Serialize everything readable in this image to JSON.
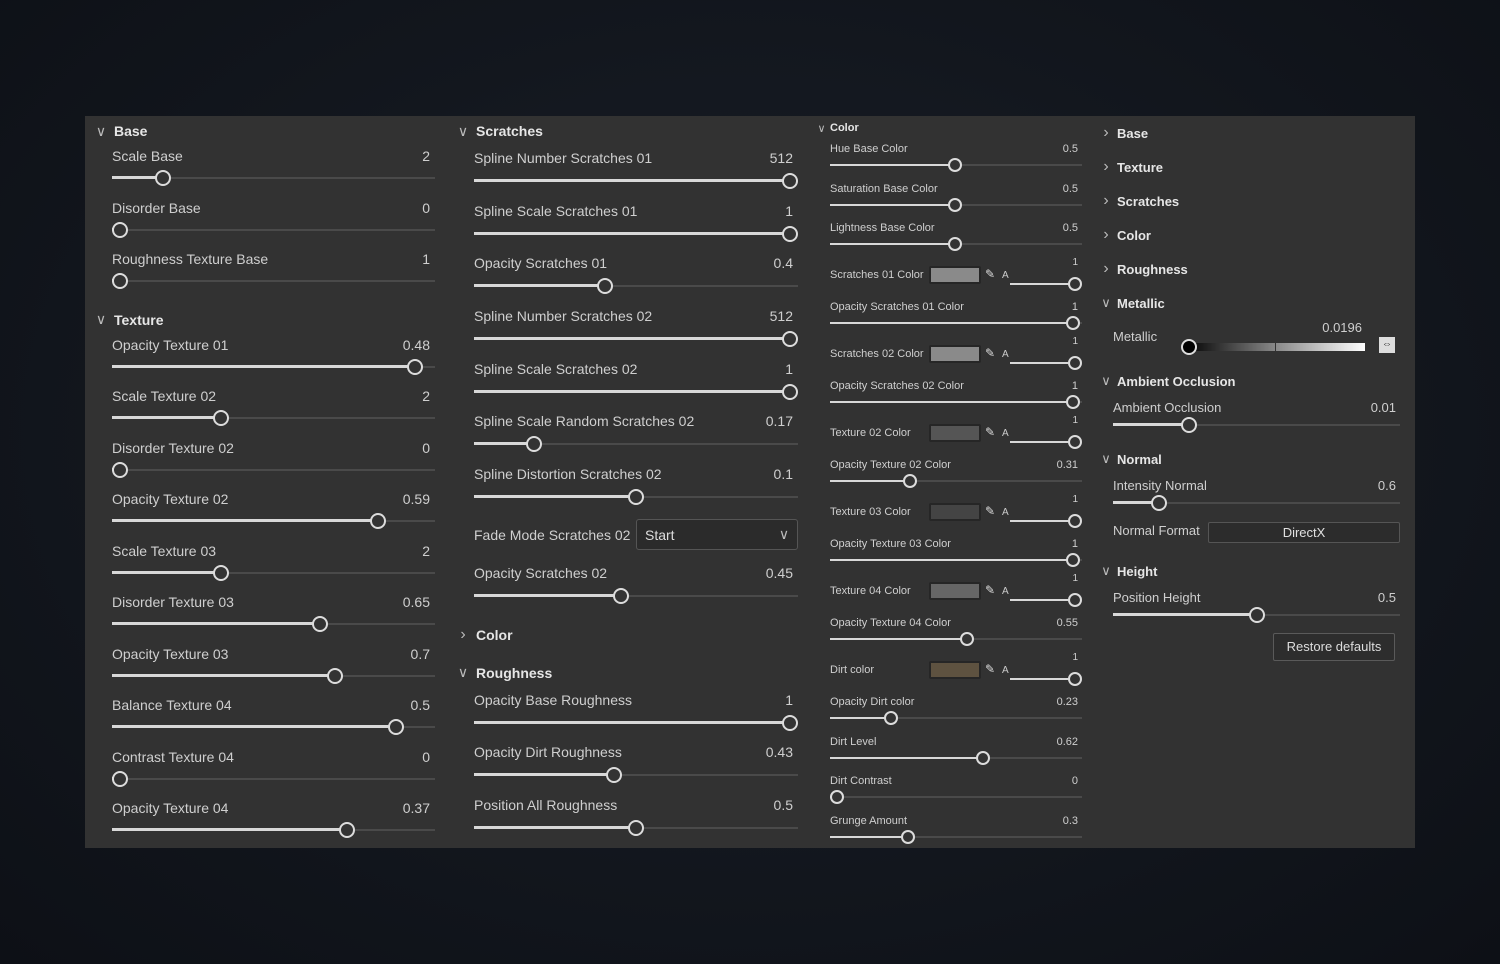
{
  "columns": [
    {
      "sections": [
        {
          "title": "Base",
          "expanded": true,
          "items": [
            {
              "type": "slider",
              "label": "Scale Base",
              "value": "2",
              "pos": 0.14
            },
            {
              "type": "slider",
              "label": "Disorder Base",
              "value": "0",
              "pos": 0
            },
            {
              "type": "slider",
              "label": "Roughness Texture Base",
              "value": "1",
              "pos": 0
            }
          ]
        },
        {
          "title": "Texture",
          "expanded": true,
          "items": [
            {
              "type": "slider",
              "label": "Opacity Texture 01",
              "value": "0.48",
              "pos": 0.96
            },
            {
              "type": "slider",
              "label": "Scale Texture 02",
              "value": "2",
              "pos": 0.33
            },
            {
              "type": "slider",
              "label": "Disorder Texture 02",
              "value": "0",
              "pos": 0
            },
            {
              "type": "slider",
              "label": "Opacity Texture 02",
              "value": "0.59",
              "pos": 0.84
            },
            {
              "type": "slider",
              "label": "Scale Texture 03",
              "value": "2",
              "pos": 0.33
            },
            {
              "type": "slider",
              "label": "Disorder Texture 03",
              "value": "0.65",
              "pos": 0.65
            },
            {
              "type": "slider",
              "label": "Opacity Texture 03",
              "value": "0.7",
              "pos": 0.7
            },
            {
              "type": "slider",
              "label": "Balance Texture 04",
              "value": "0.5",
              "pos": 0.9
            },
            {
              "type": "slider",
              "label": "Contrast Texture 04",
              "value": "0",
              "pos": 0
            },
            {
              "type": "slider",
              "label": "Opacity Texture 04",
              "value": "0.37",
              "pos": 0.74
            }
          ]
        }
      ]
    },
    {
      "sections": [
        {
          "title": "Scratches",
          "expanded": true,
          "items": [
            {
              "type": "slider",
              "label": "Spline Number Scratches 01",
              "value": "512",
              "pos": 1
            },
            {
              "type": "slider",
              "label": "Spline Scale  Scratches 01",
              "value": "1",
              "pos": 1
            },
            {
              "type": "slider",
              "label": "Opacity Scratches 01",
              "value": "0.4",
              "pos": 0.4
            },
            {
              "type": "slider",
              "label": "Spline Number Scratches 02",
              "value": "512",
              "pos": 1
            },
            {
              "type": "slider",
              "label": "Spline Scale Scratches 02",
              "value": "1",
              "pos": 1
            },
            {
              "type": "slider",
              "label": "Spline Scale Random Scratches 02",
              "value": "0.17",
              "pos": 0.17
            },
            {
              "type": "slider",
              "label": "Spline Distortion Scratches 02",
              "value": "0.1",
              "pos": 0.5
            },
            {
              "type": "dropdown",
              "label": "Fade Mode Scratches 02",
              "value": "Start"
            },
            {
              "type": "slider",
              "label": "Opacity Scratches 02",
              "value": "0.45",
              "pos": 0.45
            }
          ]
        },
        {
          "title": "Color",
          "expanded": false,
          "items": []
        },
        {
          "title": "Roughness",
          "expanded": true,
          "items": [
            {
              "type": "slider",
              "label": "Opacity Base Roughness",
              "value": "1",
              "pos": 1
            },
            {
              "type": "slider",
              "label": "Opacity Dirt Roughness",
              "value": "0.43",
              "pos": 0.43
            },
            {
              "type": "slider",
              "label": "Position All Roughness",
              "value": "0.5",
              "pos": 0.5
            }
          ]
        }
      ]
    },
    {
      "sections": [
        {
          "title": "Color",
          "expanded": true,
          "items": [
            {
              "type": "slider",
              "label": "Hue Base Color",
              "value": "0.5",
              "pos": 0.5
            },
            {
              "type": "slider",
              "label": "Saturation Base Color",
              "value": "0.5",
              "pos": 0.5
            },
            {
              "type": "slider",
              "label": "Lightness Base Color",
              "value": "0.5",
              "pos": 0.5
            },
            {
              "type": "color",
              "label": "Scratches 01 Color",
              "swatch": "#8a8a8a",
              "alpha_label": "A",
              "value": "1"
            },
            {
              "type": "slider",
              "label": "Opacity Scratches 01 Color",
              "value": "1",
              "pos": 1
            },
            {
              "type": "color",
              "label": "Scratches 02 Color",
              "swatch": "#8a8a8a",
              "alpha_label": "A",
              "value": "1"
            },
            {
              "type": "slider",
              "label": "Opacity Scratches 02 Color",
              "value": "1",
              "pos": 1
            },
            {
              "type": "color",
              "label": "Texture 02 Color",
              "swatch": "#555555",
              "alpha_label": "A",
              "value": "1"
            },
            {
              "type": "slider",
              "label": "Opacity Texture 02 Color",
              "value": "0.31",
              "pos": 0.31
            },
            {
              "type": "color",
              "label": "Texture 03 Color",
              "swatch": "#444444",
              "alpha_label": "A",
              "value": "1"
            },
            {
              "type": "slider",
              "label": "Opacity Texture 03 Color",
              "value": "1",
              "pos": 1
            },
            {
              "type": "color",
              "label": "Texture 04 Color",
              "swatch": "#666666",
              "alpha_label": "A",
              "value": "1"
            },
            {
              "type": "slider",
              "label": "Opacity Texture 04 Color",
              "value": "0.55",
              "pos": 0.55
            },
            {
              "type": "color",
              "label": "Dirt color",
              "swatch": "#5e5240",
              "alpha_label": "A",
              "value": "1"
            },
            {
              "type": "slider",
              "label": "Opacity Dirt color",
              "value": "0.23",
              "pos": 0.23
            },
            {
              "type": "slider",
              "label": "Dirt Level",
              "value": "0.62",
              "pos": 0.62
            },
            {
              "type": "slider",
              "label": "Dirt Contrast",
              "value": "0",
              "pos": 0
            },
            {
              "type": "slider",
              "label": "Grunge Amount",
              "value": "0.3",
              "pos": 0.3
            }
          ]
        }
      ]
    },
    {
      "sections": [
        {
          "title": "Base",
          "expanded": false,
          "items": []
        },
        {
          "title": "Texture",
          "expanded": false,
          "items": []
        },
        {
          "title": "Scratches",
          "expanded": false,
          "items": []
        },
        {
          "title": "Color",
          "expanded": false,
          "items": []
        },
        {
          "title": "Roughness",
          "expanded": false,
          "items": []
        },
        {
          "title": "Metallic",
          "expanded": true,
          "items": [
            {
              "type": "gradient",
              "label": "Metallic",
              "value": "0.0196",
              "pos": 0.0196
            }
          ]
        },
        {
          "title": "Ambient Occlusion",
          "expanded": true,
          "items": [
            {
              "type": "slider",
              "label": "Ambient Occlusion",
              "value": "0.01",
              "pos": 0.25
            }
          ]
        },
        {
          "title": "Normal",
          "expanded": true,
          "items": [
            {
              "type": "slider",
              "label": "Intensity Normal",
              "value": "0.6",
              "pos": 0.14
            },
            {
              "type": "select",
              "label": "Normal Format",
              "value": "DirectX"
            }
          ]
        },
        {
          "title": "Height",
          "expanded": true,
          "items": [
            {
              "type": "slider",
              "label": "Position Height",
              "value": "0.5",
              "pos": 0.5
            },
            {
              "type": "button",
              "label": "Restore defaults"
            }
          ]
        }
      ]
    }
  ],
  "colors": {
    "panel": "#323232",
    "track_fill": "#d8d8d8",
    "track_bg": "#4a4a4a"
  }
}
